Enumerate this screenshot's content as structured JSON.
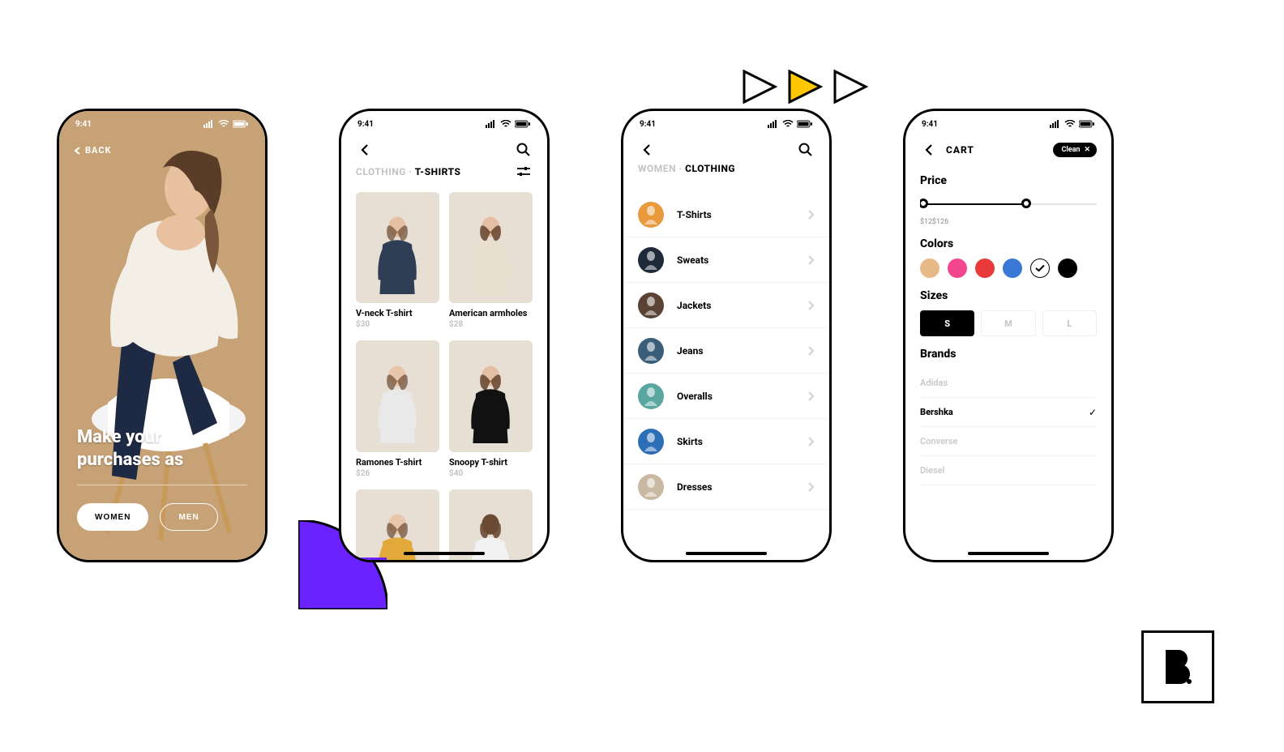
{
  "status": {
    "time": "9:41"
  },
  "screen1": {
    "back_label": "BACK",
    "headline_line1": "Make your",
    "headline_line2": "purchases as",
    "women_label": "WOMEN",
    "men_label": "MEN"
  },
  "screen2": {
    "crumb_prefix": "CLOTHING",
    "crumb_divider": "·",
    "crumb_current": "T-SHIRTS",
    "products": [
      {
        "title": "V-neck T-shirt",
        "price": "$30",
        "shirt": "#2d3e55",
        "skin": "#e5bfa2"
      },
      {
        "title": "American armholes",
        "price": "$28",
        "shirt": "#e8dfcf",
        "skin": "#e5bfa2"
      },
      {
        "title": "Ramones T-shirt",
        "price": "$26",
        "shirt": "#e9e9e9",
        "skin": "#e9c6a9"
      },
      {
        "title": "Snoopy T-shirt",
        "price": "$40",
        "shirt": "#111111",
        "skin": "#e5bfa2"
      },
      {
        "title": "",
        "price": "",
        "shirt": "#e2a93a",
        "skin": "#e9c6a9"
      },
      {
        "title": "",
        "price": "",
        "shirt": "#f2f2f2",
        "skin": "#6b4a33"
      }
    ]
  },
  "screen3": {
    "crumb_prefix": "WOMEN",
    "crumb_divider": "·",
    "crumb_current": "CLOTHING",
    "categories": [
      {
        "label": "T-Shirts",
        "color": "#e89a3d"
      },
      {
        "label": "Sweats",
        "color": "#1e2a38"
      },
      {
        "label": "Jackets",
        "color": "#5a4334"
      },
      {
        "label": "Jeans",
        "color": "#3a5e7a"
      },
      {
        "label": "Overalls",
        "color": "#5aa7a0"
      },
      {
        "label": "Skirts",
        "color": "#2d6fb6"
      },
      {
        "label": "Dresses",
        "color": "#c9b9a3"
      }
    ]
  },
  "screen4": {
    "title": "CART",
    "chip_label": "Clean",
    "sections": {
      "price": "Price",
      "colors": "Colors",
      "sizes": "Sizes",
      "brands": "Brands"
    },
    "price_min": "$12",
    "price_max": "$126",
    "colors": [
      {
        "hex": "#e6b987",
        "selected": false
      },
      {
        "hex": "#f2478f",
        "selected": false
      },
      {
        "hex": "#e83a3a",
        "selected": false
      },
      {
        "hex": "#3a78d6",
        "selected": false
      },
      {
        "hex": "#ffffff",
        "selected": true
      },
      {
        "hex": "#000000",
        "selected": false
      }
    ],
    "sizes": [
      {
        "label": "S",
        "active": true
      },
      {
        "label": "M",
        "active": false
      },
      {
        "label": "L",
        "active": false
      }
    ],
    "brands": [
      {
        "label": "Adidas",
        "selected": false,
        "dim": true
      },
      {
        "label": "Bershka",
        "selected": true,
        "dim": false
      },
      {
        "label": "Converse",
        "selected": false,
        "dim": true
      },
      {
        "label": "Diesel",
        "selected": false,
        "dim": true
      }
    ]
  }
}
